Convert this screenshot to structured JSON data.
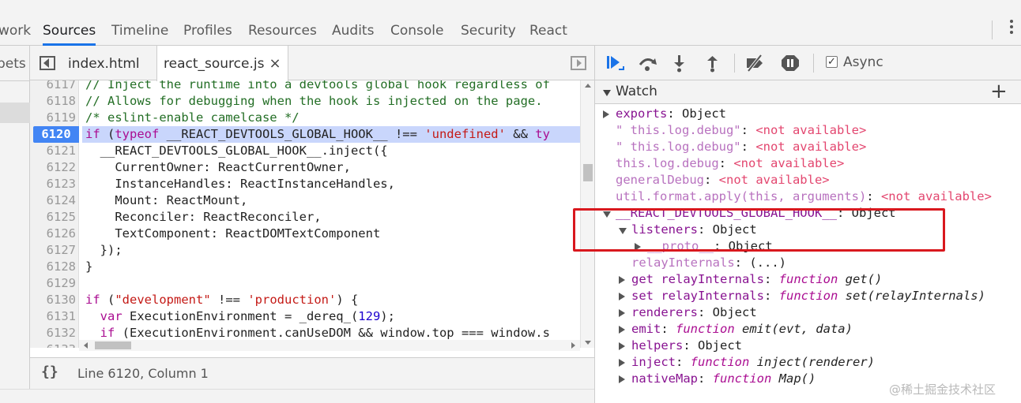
{
  "top_tabs": [
    {
      "label": "work",
      "active": false
    },
    {
      "label": "Sources",
      "active": true
    },
    {
      "label": "Timeline",
      "active": false
    },
    {
      "label": "Profiles",
      "active": false
    },
    {
      "label": "Resources",
      "active": false
    },
    {
      "label": "Audits",
      "active": false
    },
    {
      "label": "Console",
      "active": false
    },
    {
      "label": "Security",
      "active": false
    },
    {
      "label": "React",
      "active": false
    }
  ],
  "navigator": {
    "tab_label": "pets"
  },
  "file_tabs": [
    {
      "label": "index.html",
      "active": false
    },
    {
      "label": "react_source.js",
      "active": true,
      "close": "×"
    }
  ],
  "code": {
    "current_line": 6120,
    "lines": [
      {
        "n": "6117",
        "parts": [
          {
            "t": "// Inject the runtime into a devtools global hook regardless of",
            "c": "cm"
          }
        ]
      },
      {
        "n": "6118",
        "parts": [
          {
            "t": "// Allows for debugging when the hook is injected on the page.",
            "c": "cm"
          }
        ]
      },
      {
        "n": "6119",
        "parts": [
          {
            "t": "/* eslint-enable camelcase */",
            "c": "cm"
          }
        ]
      },
      {
        "n": "6120",
        "exec": true,
        "parts": [
          {
            "t": "if",
            "c": "kw"
          },
          {
            "t": " (",
            "c": ""
          },
          {
            "t": "typeof",
            "c": "kw"
          },
          {
            "t": " __REACT_DEVTOOLS_GLOBAL_HOOK__ !== ",
            "c": ""
          },
          {
            "t": "'undefined'",
            "c": "str"
          },
          {
            "t": " && ",
            "c": ""
          },
          {
            "t": "ty",
            "c": "kw"
          }
        ]
      },
      {
        "n": "6121",
        "parts": [
          {
            "t": "  __REACT_DEVTOOLS_GLOBAL_HOOK__.inject({",
            "c": ""
          }
        ]
      },
      {
        "n": "6122",
        "parts": [
          {
            "t": "    CurrentOwner: ReactCurrentOwner,",
            "c": ""
          }
        ]
      },
      {
        "n": "6123",
        "parts": [
          {
            "t": "    InstanceHandles: ReactInstanceHandles,",
            "c": ""
          }
        ]
      },
      {
        "n": "6124",
        "parts": [
          {
            "t": "    Mount: ReactMount,",
            "c": ""
          }
        ]
      },
      {
        "n": "6125",
        "parts": [
          {
            "t": "    Reconciler: ReactReconciler,",
            "c": ""
          }
        ]
      },
      {
        "n": "6126",
        "parts": [
          {
            "t": "    TextComponent: ReactDOMTextComponent",
            "c": ""
          }
        ]
      },
      {
        "n": "6127",
        "parts": [
          {
            "t": "  });",
            "c": ""
          }
        ]
      },
      {
        "n": "6128",
        "parts": [
          {
            "t": "}",
            "c": ""
          }
        ]
      },
      {
        "n": "6129",
        "parts": []
      },
      {
        "n": "6130",
        "parts": [
          {
            "t": "if",
            "c": "kw"
          },
          {
            "t": " (",
            "c": ""
          },
          {
            "t": "\"development\"",
            "c": "str"
          },
          {
            "t": " !== ",
            "c": ""
          },
          {
            "t": "'production'",
            "c": "str"
          },
          {
            "t": ") {",
            "c": ""
          }
        ]
      },
      {
        "n": "6131",
        "parts": [
          {
            "t": "  ",
            "c": ""
          },
          {
            "t": "var",
            "c": "kw"
          },
          {
            "t": " ExecutionEnvironment = _dereq_(",
            "c": ""
          },
          {
            "t": "129",
            "c": "num"
          },
          {
            "t": ");",
            "c": ""
          }
        ]
      },
      {
        "n": "6132",
        "parts": [
          {
            "t": "  ",
            "c": ""
          },
          {
            "t": "if",
            "c": "kw"
          },
          {
            "t": " (ExecutionEnvironment.canUseDOM && window.top === window.s",
            "c": ""
          }
        ]
      },
      {
        "n": "6133",
        "parts": []
      }
    ]
  },
  "status": {
    "braces": "{}",
    "position": "Line 6120, Column 1"
  },
  "debugger": {
    "async_label": "Async",
    "async_checked": "✓",
    "watch_title": "Watch",
    "watch_add": "+"
  },
  "watch_items": [
    {
      "indent": 0,
      "arrow": "collapsed",
      "parts": [
        {
          "t": "exports",
          "c": "key"
        },
        {
          "t": ": Object",
          "c": "val"
        }
      ]
    },
    {
      "indent": 0,
      "arrow": "none",
      "parts": [
        {
          "t": "\" this.log.debug\"",
          "c": "key dim"
        },
        {
          "t": ": ",
          "c": "val"
        },
        {
          "t": "<not available>",
          "c": "na"
        }
      ]
    },
    {
      "indent": 0,
      "arrow": "none",
      "parts": [
        {
          "t": "\" this.log.debug\"",
          "c": "key dim"
        },
        {
          "t": ": ",
          "c": "val"
        },
        {
          "t": "<not available>",
          "c": "na"
        }
      ]
    },
    {
      "indent": 0,
      "arrow": "none",
      "parts": [
        {
          "t": "this.log.debug",
          "c": "key dim"
        },
        {
          "t": ": ",
          "c": "val"
        },
        {
          "t": "<not available>",
          "c": "na"
        }
      ]
    },
    {
      "indent": 0,
      "arrow": "none",
      "parts": [
        {
          "t": "generalDebug",
          "c": "key dim"
        },
        {
          "t": ": ",
          "c": "val"
        },
        {
          "t": "<not available>",
          "c": "na"
        }
      ]
    },
    {
      "indent": 0,
      "arrow": "none",
      "parts": [
        {
          "t": "util.format.apply(this, arguments)",
          "c": "key dim"
        },
        {
          "t": ": ",
          "c": "val"
        },
        {
          "t": "<not available>",
          "c": "na"
        }
      ]
    },
    {
      "indent": 0,
      "arrow": "expanded",
      "parts": [
        {
          "t": "__REACT_DEVTOOLS_GLOBAL_HOOK__",
          "c": "key"
        },
        {
          "t": ": Object",
          "c": "val"
        }
      ]
    },
    {
      "indent": 1,
      "arrow": "expanded",
      "parts": [
        {
          "t": "listeners",
          "c": "key"
        },
        {
          "t": ": Object",
          "c": "val"
        }
      ]
    },
    {
      "indent": 2,
      "arrow": "collapsed",
      "parts": [
        {
          "t": "__proto__",
          "c": "key dim"
        },
        {
          "t": ": Object",
          "c": "val"
        }
      ]
    },
    {
      "indent": 1,
      "arrow": "none",
      "parts": [
        {
          "t": "relayInternals",
          "c": "key dim"
        },
        {
          "t": ": (...)",
          "c": "val"
        }
      ]
    },
    {
      "indent": 1,
      "arrow": "collapsed",
      "parts": [
        {
          "t": "get ",
          "c": "key"
        },
        {
          "t": "relayInternals",
          "c": "key"
        },
        {
          "t": ": ",
          "c": "val"
        },
        {
          "t": "function",
          "c": "fnkw"
        },
        {
          "t": " get()",
          "c": "fnsig"
        }
      ]
    },
    {
      "indent": 1,
      "arrow": "collapsed",
      "parts": [
        {
          "t": "set ",
          "c": "key"
        },
        {
          "t": "relayInternals",
          "c": "key"
        },
        {
          "t": ": ",
          "c": "val"
        },
        {
          "t": "function",
          "c": "fnkw"
        },
        {
          "t": " set(relayInternals)",
          "c": "fnsig"
        }
      ]
    },
    {
      "indent": 1,
      "arrow": "collapsed",
      "parts": [
        {
          "t": "renderers",
          "c": "key"
        },
        {
          "t": ": Object",
          "c": "val"
        }
      ]
    },
    {
      "indent": 1,
      "arrow": "collapsed",
      "parts": [
        {
          "t": "emit",
          "c": "key"
        },
        {
          "t": ": ",
          "c": "val"
        },
        {
          "t": "function",
          "c": "fnkw"
        },
        {
          "t": " emit(evt, data)",
          "c": "fnsig"
        }
      ]
    },
    {
      "indent": 1,
      "arrow": "collapsed",
      "parts": [
        {
          "t": "helpers",
          "c": "key"
        },
        {
          "t": ": Object",
          "c": "val"
        }
      ]
    },
    {
      "indent": 1,
      "arrow": "collapsed",
      "parts": [
        {
          "t": "inject",
          "c": "key"
        },
        {
          "t": ": ",
          "c": "val"
        },
        {
          "t": "function",
          "c": "fnkw"
        },
        {
          "t": " inject(renderer)",
          "c": "fnsig"
        }
      ]
    },
    {
      "indent": 1,
      "arrow": "collapsed",
      "parts": [
        {
          "t": "nativeMap",
          "c": "key"
        },
        {
          "t": ": ",
          "c": "val"
        },
        {
          "t": "function",
          "c": "fnkw"
        },
        {
          "t": " Map()",
          "c": "fnsig"
        }
      ]
    }
  ],
  "watermark": "@稀土掘金技术社区",
  "colors": {
    "accent": "#1a73e8",
    "breakpoint": "#4285f4",
    "exec_line": "#c9d6fc",
    "highlight_box": "#d9181e"
  }
}
